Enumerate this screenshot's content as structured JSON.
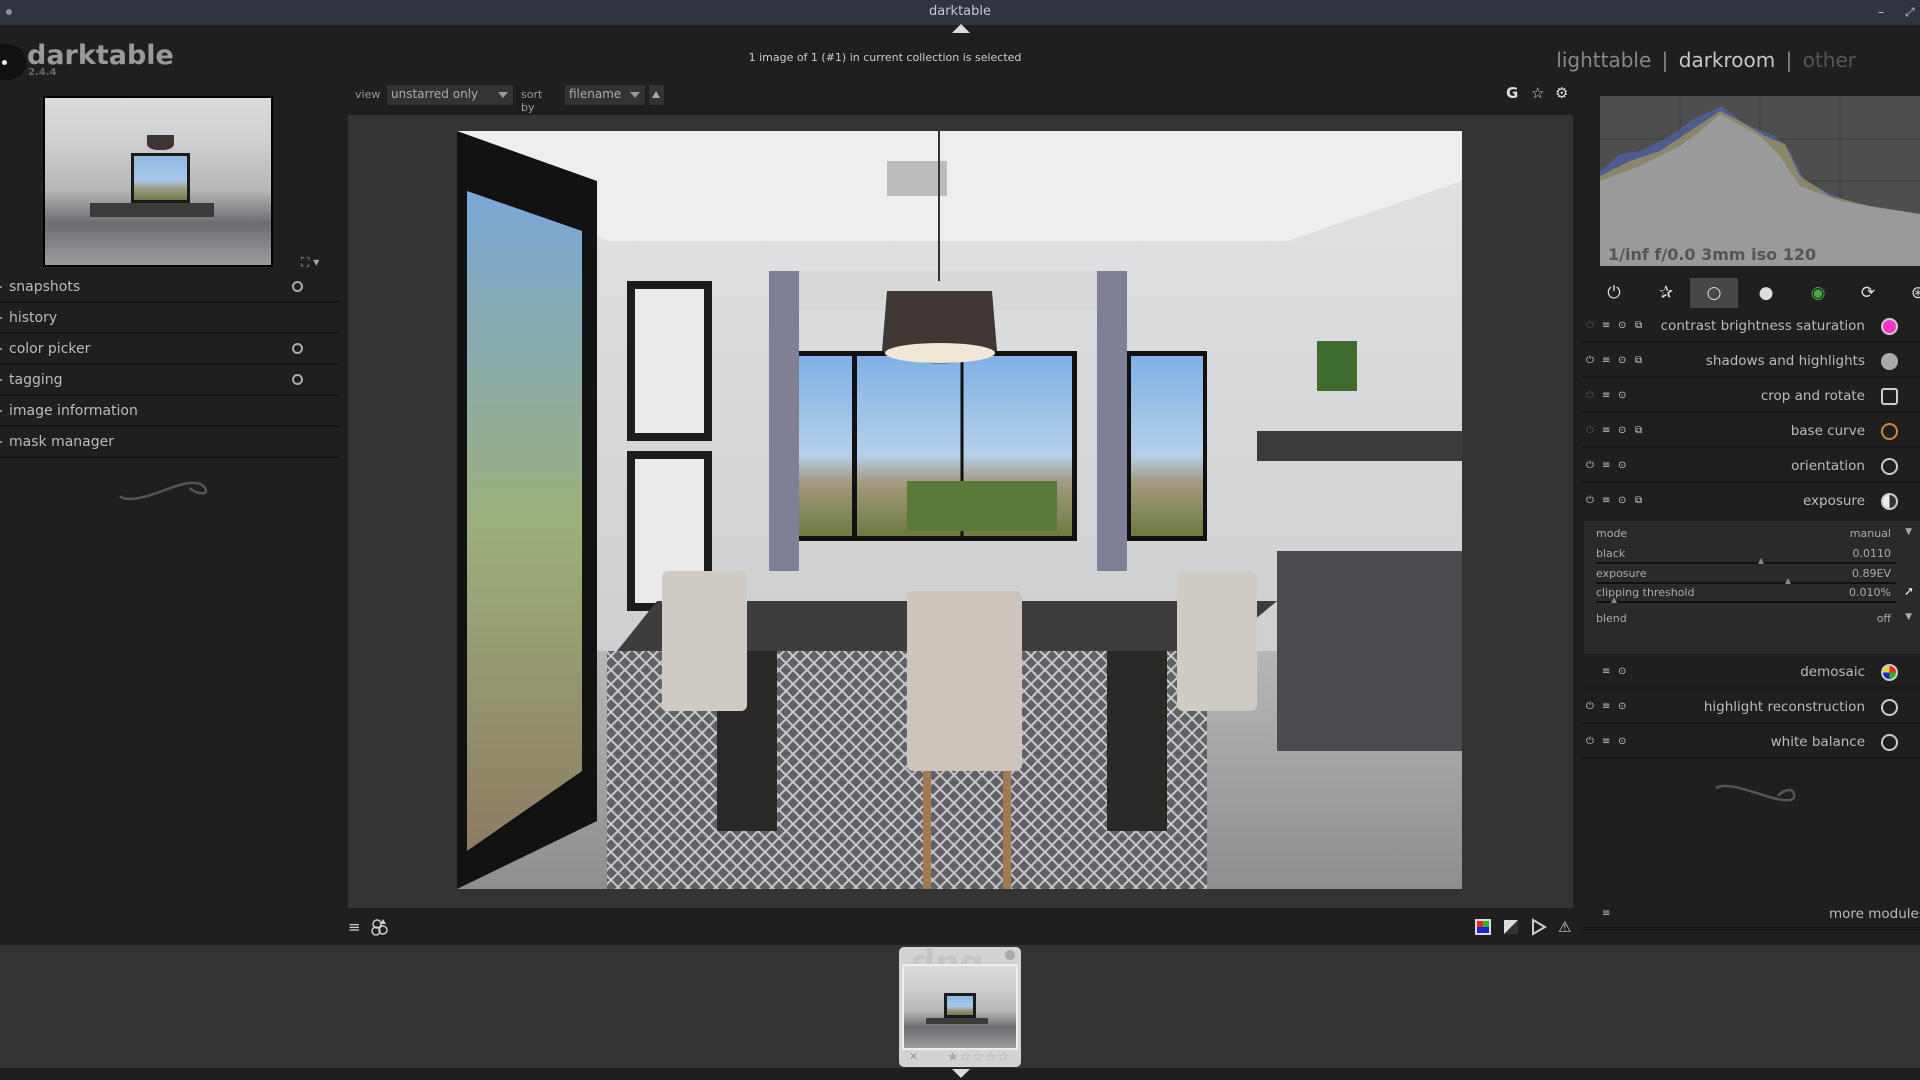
{
  "window": {
    "title": "darktable",
    "minimize_glyph": "–",
    "maximize_glyph": "⤢"
  },
  "brand": {
    "name": "darktable",
    "version": "2.4.4"
  },
  "status_text": "1 image of 1 (#1) in current collection is selected",
  "views": {
    "lighttable": "lighttable",
    "darkroom": "darkroom",
    "other": "other",
    "separator": "|",
    "active": "darkroom"
  },
  "left_panel": {
    "items": [
      {
        "label": "snapshots",
        "has_reset": true
      },
      {
        "label": "history",
        "has_reset": false
      },
      {
        "label": "color picker",
        "has_reset": true
      },
      {
        "label": "tagging",
        "has_reset": true
      },
      {
        "label": "image information",
        "has_reset": false
      },
      {
        "label": "mask manager",
        "has_reset": false
      }
    ]
  },
  "filter_bar": {
    "view_label": "view",
    "view_value": "unstarred only",
    "sort_label": "sort by",
    "sort_value": "filename"
  },
  "top_right_icons": {
    "grouping": "G",
    "star": "☆",
    "gear": "⚙"
  },
  "histogram": {
    "exif": "1/inf f/0.0 3mm iso 120"
  },
  "module_groups": [
    {
      "name": "active-modules",
      "glyph": "⏻"
    },
    {
      "name": "favorites",
      "glyph": "✰"
    },
    {
      "name": "basic",
      "glyph": "○",
      "active": true
    },
    {
      "name": "tone",
      "glyph": "●"
    },
    {
      "name": "color",
      "glyph": "◉"
    },
    {
      "name": "correct",
      "glyph": "⟳"
    },
    {
      "name": "effect",
      "glyph": "⊛"
    }
  ],
  "modules": [
    {
      "name": "contrast brightness saturation",
      "enabled": false,
      "has_presets": true,
      "icon": "contrast-icon"
    },
    {
      "name": "shadows and highlights",
      "enabled": true,
      "has_presets": true,
      "icon": "shadows-icon"
    },
    {
      "name": "crop and rotate",
      "enabled": false,
      "has_presets": false,
      "icon": "crop-icon"
    },
    {
      "name": "base curve",
      "enabled": false,
      "has_presets": true,
      "icon": "curve-icon"
    },
    {
      "name": "orientation",
      "enabled": true,
      "has_presets": false,
      "icon": "orientation-icon"
    },
    {
      "name": "exposure",
      "enabled": true,
      "has_presets": true,
      "icon": "exposure-icon",
      "expanded": true
    }
  ],
  "exposure": {
    "mode_label": "mode",
    "mode_value": "manual",
    "black_label": "black",
    "black_value": "0.0110",
    "black_pos": 0.55,
    "exposure_label": "exposure",
    "exposure_value": "0.89EV",
    "exposure_pos": 0.64,
    "clip_label": "clipping threshold",
    "clip_value": "0.010%",
    "clip_pos": 0.06,
    "blend_label": "blend",
    "blend_value": "off"
  },
  "modules_bottom": [
    {
      "name": "demosaic",
      "has_power": false,
      "icon": "demosaic-icon"
    },
    {
      "name": "highlight reconstruction",
      "has_power": true,
      "icon": "highlight-icon"
    },
    {
      "name": "white balance",
      "has_power": true,
      "icon": "white-balance-icon"
    }
  ],
  "more_modules": "more modules",
  "filmstrip": {
    "ext": "dng",
    "stars": "★☆☆☆☆",
    "reject": "✕"
  },
  "bottom_icons": {
    "presets": "≡",
    "styles": "styles",
    "color_check": "color-assessment",
    "softproof": "softproof",
    "gamut": "gamut-check",
    "overexposed": "⚠"
  }
}
